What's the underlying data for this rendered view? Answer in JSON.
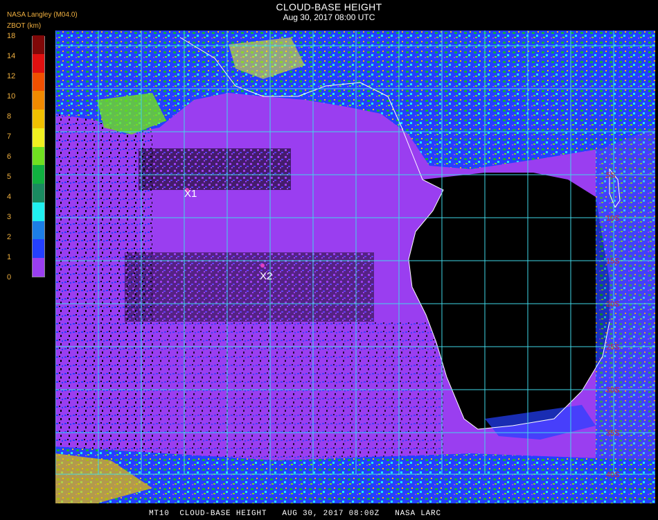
{
  "header": {
    "title": "CLOUD-BASE HEIGHT",
    "subtitle": "Aug 30, 2017 08:00 UTC",
    "org": "NASA Langley (M04.0)",
    "units": "ZBOT (km)"
  },
  "colorbar": {
    "ticks": [
      "0",
      "1",
      "2",
      "3",
      "4",
      "5",
      "6",
      "7",
      "8",
      "10",
      "12",
      "14",
      "18"
    ],
    "colors": [
      "#9a3ef0",
      "#2440ff",
      "#1c7ee6",
      "#20f0f0",
      "#1a8a60",
      "#10b040",
      "#70e020",
      "#f0f020",
      "#f0c000",
      "#f08a00",
      "#f05000",
      "#e01010",
      "#800808"
    ]
  },
  "map": {
    "markers": [
      {
        "label": "X1"
      },
      {
        "label": "X2"
      }
    ],
    "lat_labels": [
      "5S",
      "10S",
      "15S",
      "20S",
      "25S",
      "30S",
      "35S",
      "40S"
    ],
    "colors": {
      "ocean_cloud": "#9a3ef0",
      "clear": "#000000",
      "grid": "#40d8e8",
      "coast": "#ffffff",
      "marker": "#e040c0"
    }
  },
  "footer": "MT10  CLOUD-BASE HEIGHT   AUG 30, 2017 08:00Z   NASA LARC"
}
